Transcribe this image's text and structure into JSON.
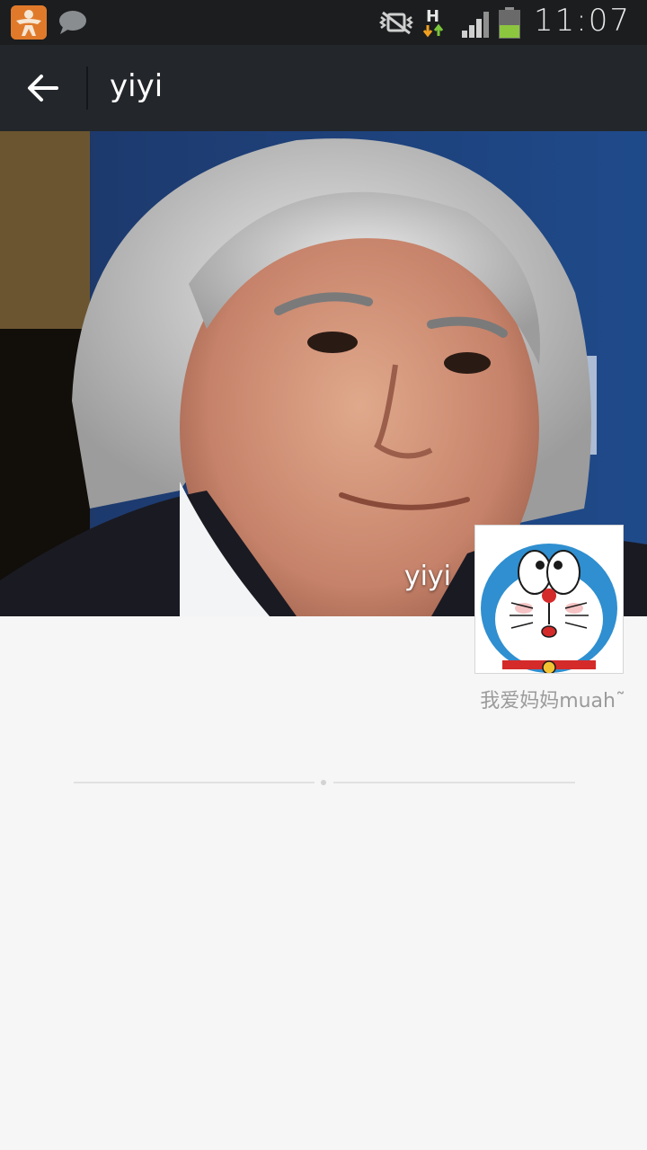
{
  "status_bar": {
    "time": "11:07",
    "icons": [
      "app-notification-icon",
      "chat-bubble-icon",
      "vibrate-icon",
      "hspa-data-icon",
      "signal-icon",
      "battery-icon"
    ],
    "battery_color": "#8cc63f"
  },
  "action_bar": {
    "back_icon": "arrow-left-icon",
    "title": "yiyi"
  },
  "profile": {
    "cover_name": "yiyi",
    "avatar_icon": "doraemon-avatar",
    "signature": "我爱妈妈muah˜"
  },
  "colors": {
    "status_bar_bg": "#1b1d1f",
    "action_bar_bg": "#23272b",
    "page_bg": "#f6f6f6",
    "signature_text": "#9b9b9b"
  }
}
